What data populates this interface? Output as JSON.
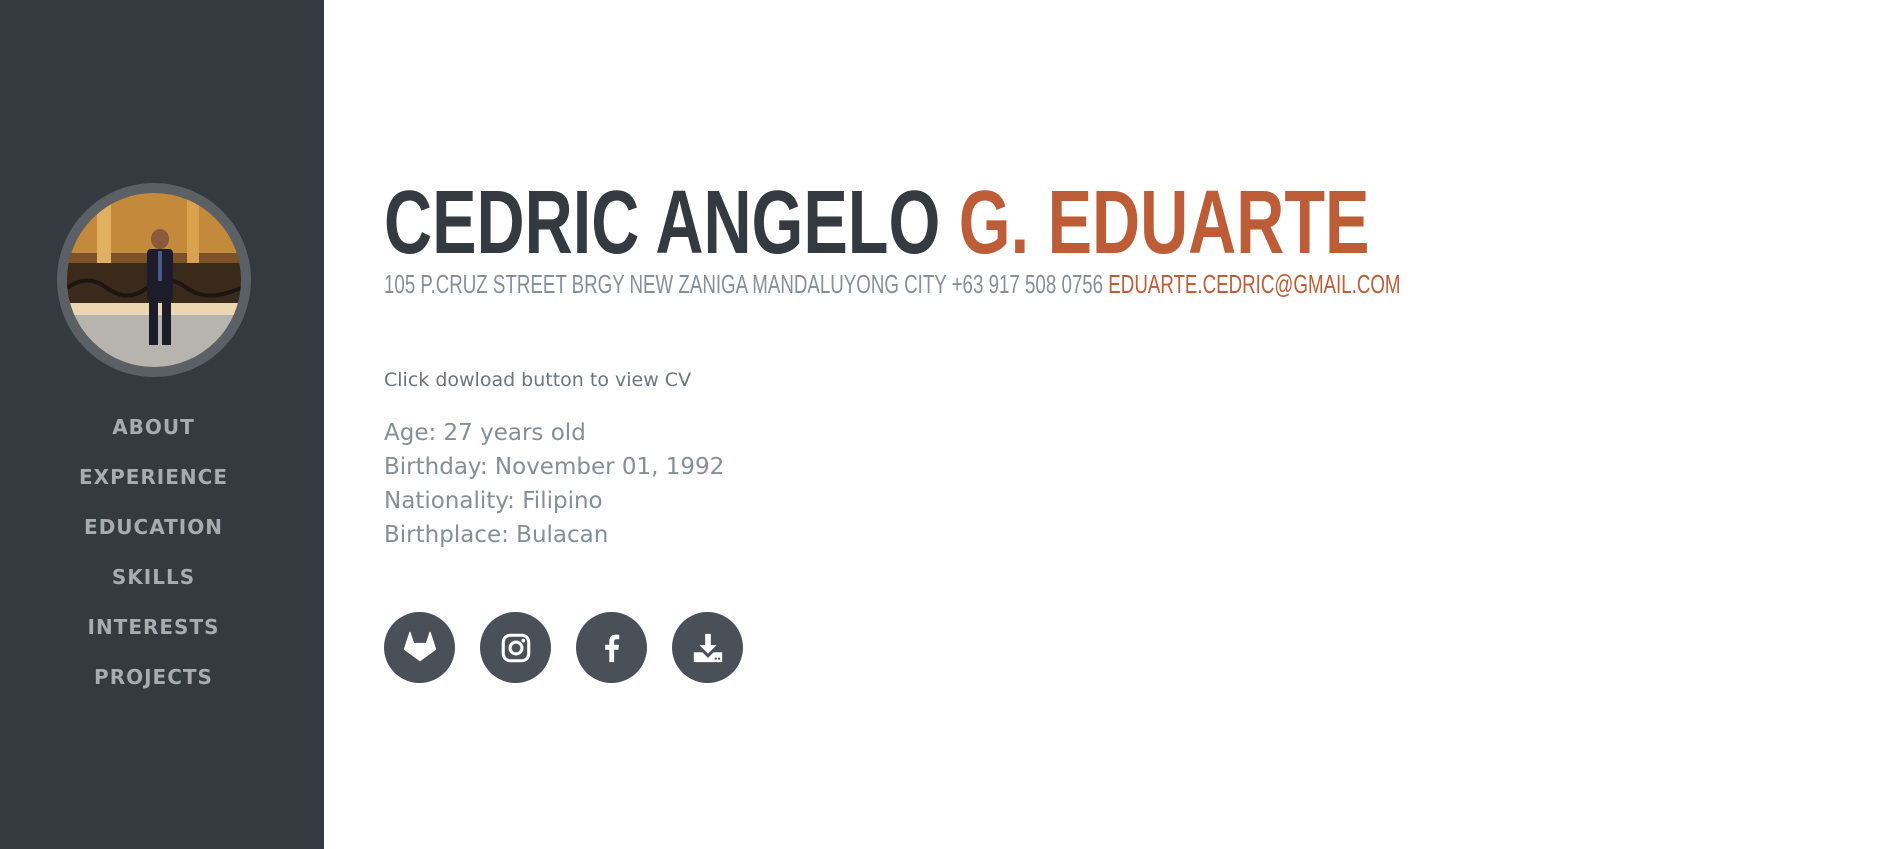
{
  "sidebar": {
    "nav": [
      {
        "label": "ABOUT"
      },
      {
        "label": "EXPERIENCE"
      },
      {
        "label": "EDUCATION"
      },
      {
        "label": "SKILLS"
      },
      {
        "label": "INTERESTS"
      },
      {
        "label": "PROJECTS"
      }
    ]
  },
  "profile": {
    "first_name": "CEDRIC ANGELO",
    "last_name": "G. EDUARTE",
    "address_phone": "105 P.CRUZ STREET BRGY NEW ZANIGA MANDALUYONG CITY +63 917 508 0756",
    "email": "EDUARTE.CEDRIC@GMAIL.COM",
    "note": "Click dowload button to view CV",
    "facts": [
      "Age: 27 years old",
      "Birthday: November 01, 1992",
      "Nationality: Filipino",
      "Birthplace: Bulacan"
    ]
  },
  "social": [
    {
      "icon": "gitlab-icon"
    },
    {
      "icon": "instagram-icon"
    },
    {
      "icon": "facebook-icon"
    },
    {
      "icon": "download-icon"
    }
  ],
  "colors": {
    "sidebar_bg": "#343a40",
    "accent": "#bd5d38",
    "heading": "#343a40",
    "muted": "#868e96",
    "button_bg": "#495057"
  }
}
